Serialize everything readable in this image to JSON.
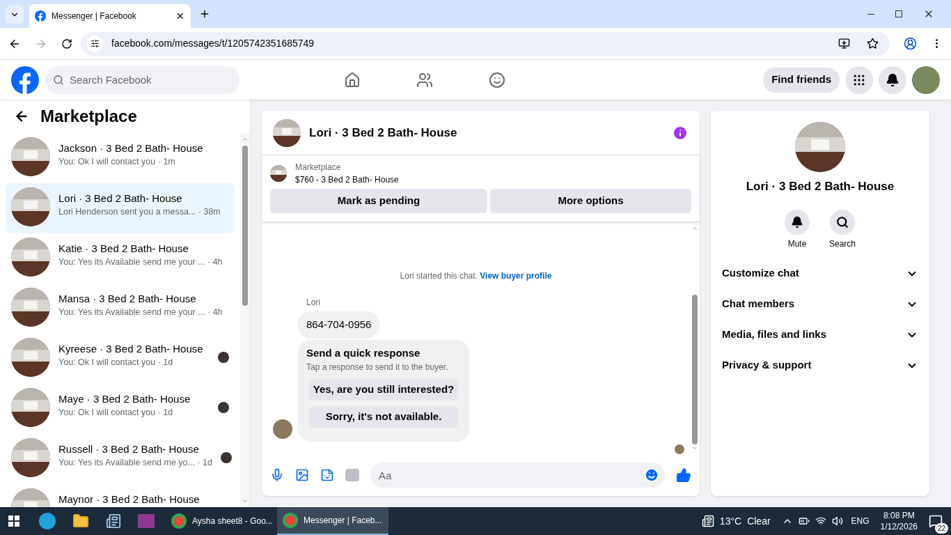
{
  "browser": {
    "tab": {
      "title": "Messenger | Facebook"
    },
    "url": "facebook.com/messages/t/1205742351685749"
  },
  "header": {
    "search": {
      "placeholder": "Search Facebook"
    },
    "find_friends": "Find friends"
  },
  "sidebar": {
    "title": "Marketplace",
    "conversations": [
      {
        "title": "Jackson · 3 Bed 2 Bath- House",
        "preview": "You: Ok I will contact you · 1m",
        "selected": false,
        "seen": false
      },
      {
        "title": "Lori · 3 Bed 2 Bath- House",
        "preview": "Lori Henderson sent you a messa... · 38m",
        "selected": true,
        "seen": false
      },
      {
        "title": "Katie · 3 Bed 2 Bath- House",
        "preview": "You: Yes its Available send me your ... · 4h",
        "selected": false,
        "seen": false
      },
      {
        "title": "Mansa · 3 Bed 2 Bath- House",
        "preview": "You: Yes its Available send me your ... · 4h",
        "selected": false,
        "seen": false
      },
      {
        "title": "Kyreese · 3 Bed 2 Bath- House",
        "preview": "You: Ok I will contact you · 1d",
        "selected": false,
        "seen": true
      },
      {
        "title": "Maye · 3 Bed 2 Bath- House",
        "preview": "You: Ok I will contact you · 1d",
        "selected": false,
        "seen": true
      },
      {
        "title": "Russell · 3 Bed 2 Bath- House",
        "preview": "You: Yes its Available send me yo... · 1d",
        "selected": false,
        "seen": true
      },
      {
        "title": "Maynor · 3 Bed 2 Bath- House",
        "selected": false,
        "seen": false
      }
    ]
  },
  "chat": {
    "title": "Lori · 3 Bed 2 Bath- House",
    "listing": {
      "source": "Marketplace",
      "name": "$760 - 3 Bed 2 Bath- House"
    },
    "actions": [
      "Mark as pending",
      "More options"
    ],
    "notice": {
      "text": "Lori started this chat.",
      "link": "View buyer profile"
    },
    "sender": "Lori",
    "message": "864-704-0956",
    "quick_response": {
      "title": "Send a quick response",
      "subtitle": "Tap a response to send it to the buyer.",
      "options": [
        "Yes, are you still interested?",
        "Sorry, it's not available."
      ]
    },
    "composer": {
      "placeholder": "Aa"
    }
  },
  "details": {
    "title": "Lori · 3 Bed 2 Bath- House",
    "actions": [
      {
        "kind": "mute",
        "label": "Mute"
      },
      {
        "kind": "search",
        "label": "Search"
      }
    ],
    "sections": [
      {
        "label": "Customize chat",
        "expanded": false
      },
      {
        "label": "Chat members",
        "expanded": false
      },
      {
        "label": "Media, files and links",
        "expanded": false
      },
      {
        "label": "Privacy & support",
        "expanded": false
      }
    ]
  },
  "taskbar": {
    "apps": [
      {
        "label": "Aysha sheet8 - Goo...",
        "selected": false
      },
      {
        "label": "Messenger | Faceb...",
        "selected": true
      }
    ],
    "weather": {
      "temp": "13°C",
      "condition": "Clear"
    },
    "language": "ENG",
    "time": "8:08 PM",
    "date": "1/12/2026",
    "notifications": "22"
  }
}
